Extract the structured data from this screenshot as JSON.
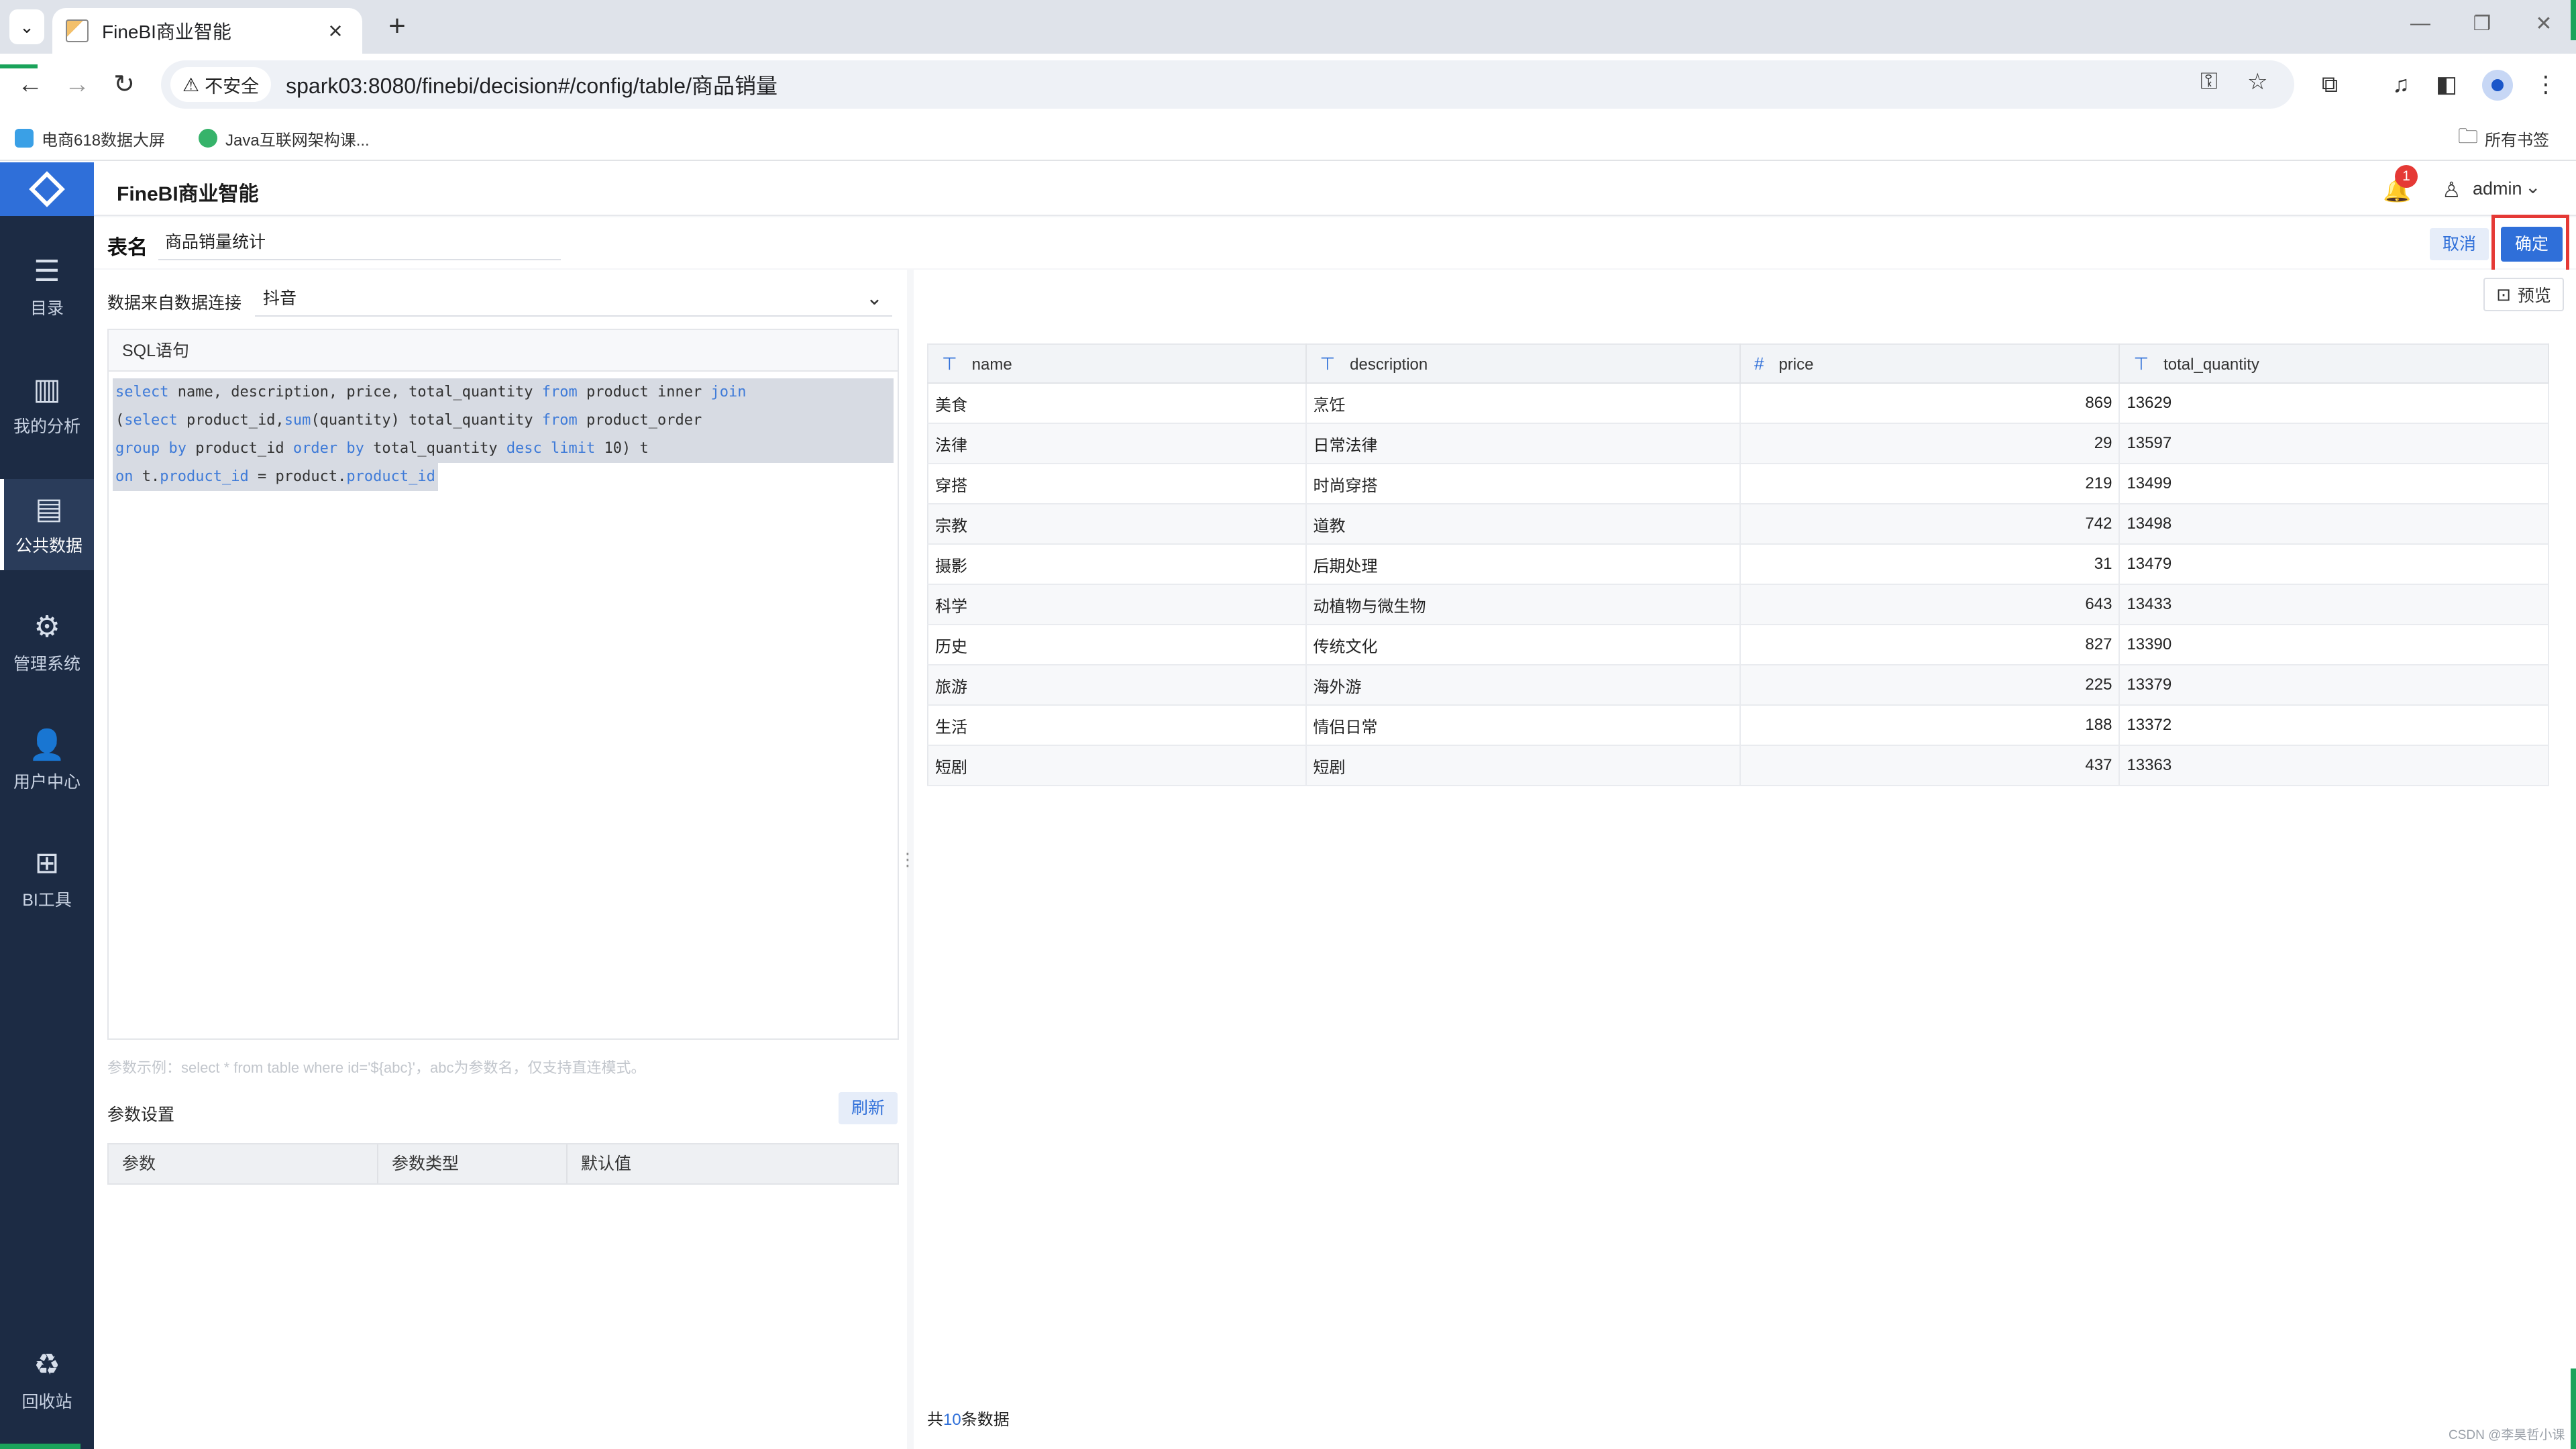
{
  "browser": {
    "tab_title": "FineBI商业智能",
    "security_label": "不安全",
    "url": "spark03:8080/finebi/decision#/config/table/商品销量",
    "bookmarks": [
      "电商618数据大屏",
      "Java互联网架构课..."
    ],
    "all_bookmarks": "所有书签"
  },
  "app": {
    "title": "FineBI商业智能",
    "notification_count": "1",
    "user": "admin"
  },
  "sidebar": {
    "items": [
      {
        "label": "目录",
        "icon": "catalog-icon"
      },
      {
        "label": "我的分析",
        "icon": "analysis-icon"
      },
      {
        "label": "公共数据",
        "icon": "public-data-icon"
      },
      {
        "label": "管理系统",
        "icon": "gear-icon"
      },
      {
        "label": "用户中心",
        "icon": "user-icon"
      },
      {
        "label": "BI工具",
        "icon": "toolbox-icon"
      },
      {
        "label": "回收站",
        "icon": "recycle-icon"
      }
    ]
  },
  "table_name": {
    "label": "表名",
    "value": "商品销量统计"
  },
  "actions": {
    "cancel": "取消",
    "confirm": "确定",
    "preview": "预览",
    "refresh": "刷新"
  },
  "connection": {
    "label": "数据来自数据连接",
    "value": "抖音"
  },
  "sql": {
    "header": "SQL语句"
  },
  "params": {
    "hint": "参数示例：select * from table where id='${abc}'，abc为参数名，仅支持直连模式。",
    "title": "参数设置",
    "columns": [
      "参数",
      "参数类型",
      "默认值"
    ]
  },
  "preview_table": {
    "columns": [
      {
        "name": "name",
        "type": "text"
      },
      {
        "name": "description",
        "type": "text"
      },
      {
        "name": "price",
        "type": "number"
      },
      {
        "name": "total_quantity",
        "type": "text"
      }
    ],
    "rows": [
      [
        "美食",
        "烹饪",
        "869",
        "13629"
      ],
      [
        "法律",
        "日常法律",
        "29",
        "13597"
      ],
      [
        "穿搭",
        "时尚穿搭",
        "219",
        "13499"
      ],
      [
        "宗教",
        "道教",
        "742",
        "13498"
      ],
      [
        "摄影",
        "后期处理",
        "31",
        "13479"
      ],
      [
        "科学",
        "动植物与微生物",
        "643",
        "13433"
      ],
      [
        "历史",
        "传统文化",
        "827",
        "13390"
      ],
      [
        "旅游",
        "海外游",
        "225",
        "13379"
      ],
      [
        "生活",
        "情侣日常",
        "188",
        "13372"
      ],
      [
        "短剧",
        "短剧",
        "437",
        "13363"
      ]
    ],
    "footer_prefix": "共",
    "footer_count": "10",
    "footer_suffix": "条数据"
  },
  "watermark": "CSDN @李昊哲小课",
  "colors": {
    "accent": "#2f6fd9",
    "sidebar_bg": "#1c2b44",
    "highlight_frame": "#e53935"
  }
}
